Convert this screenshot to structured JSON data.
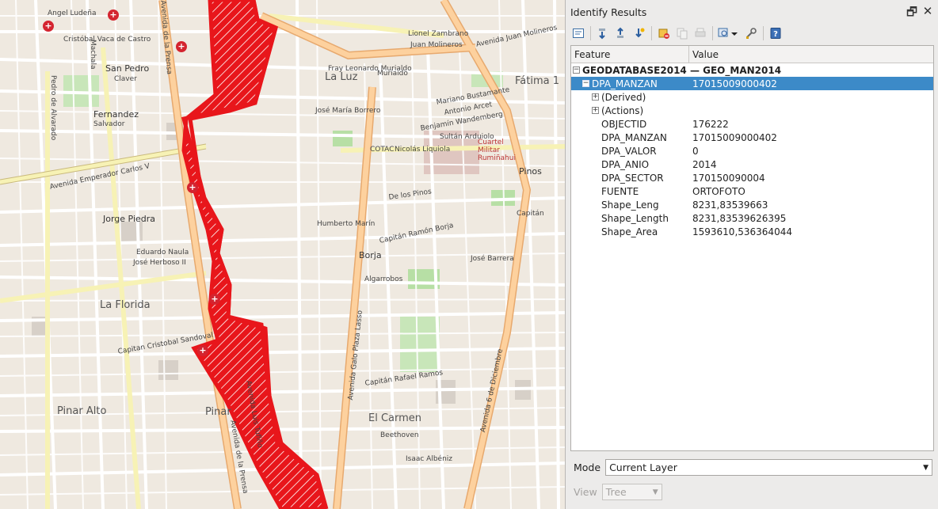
{
  "panel": {
    "title": "Identify Results",
    "float_glyph": "🗗",
    "close_glyph": "✕",
    "toolbar_icons": [
      "expand-tree-icon",
      "expand-all-icon",
      "collapse-all-icon",
      "expand-new-icon",
      "clear-results-icon",
      "copy-feature-icon",
      "print-icon",
      "identify-select-icon",
      "settings-icon",
      "help-icon"
    ],
    "columns": {
      "feature": "Feature",
      "value": "Value"
    },
    "rows": [
      {
        "indent": 0,
        "exp": "−",
        "feature": "GEODATABASE2014 — GEO_MAN2014",
        "value": "",
        "bold": true,
        "selected": false
      },
      {
        "indent": 1,
        "exp": "−",
        "feature": "DPA_MANZAN",
        "value": "17015009000402",
        "bold": false,
        "selected": true
      },
      {
        "indent": 2,
        "exp": "+",
        "feature": "(Derived)",
        "value": "",
        "bold": false,
        "selected": false
      },
      {
        "indent": 2,
        "exp": "+",
        "feature": "(Actions)",
        "value": "",
        "bold": false,
        "selected": false
      },
      {
        "indent": 2,
        "exp": "",
        "feature": "OBJECTID",
        "value": "176222",
        "bold": false,
        "selected": false
      },
      {
        "indent": 2,
        "exp": "",
        "feature": "DPA_MANZAN",
        "value": "17015009000402",
        "bold": false,
        "selected": false
      },
      {
        "indent": 2,
        "exp": "",
        "feature": "DPA_VALOR",
        "value": "0",
        "bold": false,
        "selected": false
      },
      {
        "indent": 2,
        "exp": "",
        "feature": "DPA_ANIO",
        "value": "2014",
        "bold": false,
        "selected": false
      },
      {
        "indent": 2,
        "exp": "",
        "feature": "DPA_SECTOR",
        "value": "170150090004",
        "bold": false,
        "selected": false
      },
      {
        "indent": 2,
        "exp": "",
        "feature": "FUENTE",
        "value": "ORTOFOTO",
        "bold": false,
        "selected": false
      },
      {
        "indent": 2,
        "exp": "",
        "feature": "Shape_Leng",
        "value": "8231,83539663",
        "bold": false,
        "selected": false
      },
      {
        "indent": 2,
        "exp": "",
        "feature": "Shape_Length",
        "value": "8231,83539626395",
        "bold": false,
        "selected": false
      },
      {
        "indent": 2,
        "exp": "",
        "feature": "Shape_Area",
        "value": "1593610,536364044",
        "bold": false,
        "selected": false
      }
    ],
    "mode_label": "Mode",
    "mode_value": "Current Layer",
    "view_label": "View",
    "view_value": "Tree",
    "dropdown_glyph": "▼"
  },
  "map": {
    "highlight_color": "#e8161b",
    "labels": [
      {
        "t": "Angel Ludeña",
        "c": ""
      },
      {
        "t": "Cristóbal Vaca de Castro",
        "c": ""
      },
      {
        "t": "San Pedro",
        "c": "mid"
      },
      {
        "t": "Claver",
        "c": ""
      },
      {
        "t": "Fernandez",
        "c": "mid"
      },
      {
        "t": "Salvador",
        "c": ""
      },
      {
        "t": "Avenida Emperador Carlos V",
        "c": ""
      },
      {
        "t": "Jorge Piedra",
        "c": "mid"
      },
      {
        "t": "Eduardo Naula",
        "c": ""
      },
      {
        "t": "José Herboso II",
        "c": ""
      },
      {
        "t": "La Florida",
        "c": "big"
      },
      {
        "t": "Capitan Cristobal Sandoval",
        "c": ""
      },
      {
        "t": "Pinar Alto",
        "c": "big"
      },
      {
        "t": "Pinar",
        "c": "big"
      },
      {
        "t": "La Luz",
        "c": "big"
      },
      {
        "t": "Muriaido",
        "c": ""
      },
      {
        "t": "José María Borrero",
        "c": ""
      },
      {
        "t": "COTAC",
        "c": ""
      },
      {
        "t": "Nicolás Liquiola",
        "c": ""
      },
      {
        "t": "Cuartel Militar Rumiñahui",
        "c": ""
      },
      {
        "t": "Humberto Marín",
        "c": ""
      },
      {
        "t": "Capitán Ramón Borja",
        "c": ""
      },
      {
        "t": "Borja",
        "c": "mid"
      },
      {
        "t": "De los Pinos",
        "c": ""
      },
      {
        "t": "Pinos",
        "c": "mid"
      },
      {
        "t": "Algarrobos",
        "c": ""
      },
      {
        "t": "Capitán Rafael Ramos",
        "c": ""
      },
      {
        "t": "El Carmen",
        "c": "big"
      },
      {
        "t": "Beethoven",
        "c": ""
      },
      {
        "t": "Isaac Albéniz",
        "c": ""
      },
      {
        "t": "Fátima 1",
        "c": "big"
      },
      {
        "t": "Avenida Juan Molineros",
        "c": ""
      },
      {
        "t": "Lionel Zambrano",
        "c": ""
      },
      {
        "t": "Juan Molineros",
        "c": ""
      },
      {
        "t": "Fray Leonardo Murialdo",
        "c": ""
      },
      {
        "t": "Mariano Bustamante",
        "c": ""
      },
      {
        "t": "Antonio Arcet",
        "c": ""
      },
      {
        "t": "Benjamín Wandemberg",
        "c": ""
      },
      {
        "t": "Sultán Arduiolo",
        "c": ""
      },
      {
        "t": "Avenida de la Prensa",
        "c": ""
      },
      {
        "t": "Avenida Galo Plaza Lasso",
        "c": ""
      },
      {
        "t": "Avenida 6 de Diciembre",
        "c": ""
      },
      {
        "t": "Avenida de la Prensa",
        "c": ""
      },
      {
        "t": "Pedro de Alvarado",
        "c": ""
      },
      {
        "t": "Machala",
        "c": ""
      },
      {
        "t": "Capitán",
        "c": ""
      },
      {
        "t": "José Barrera",
        "c": ""
      },
      {
        "t": "Avenida Luis Tufiño",
        "c": ""
      }
    ]
  }
}
